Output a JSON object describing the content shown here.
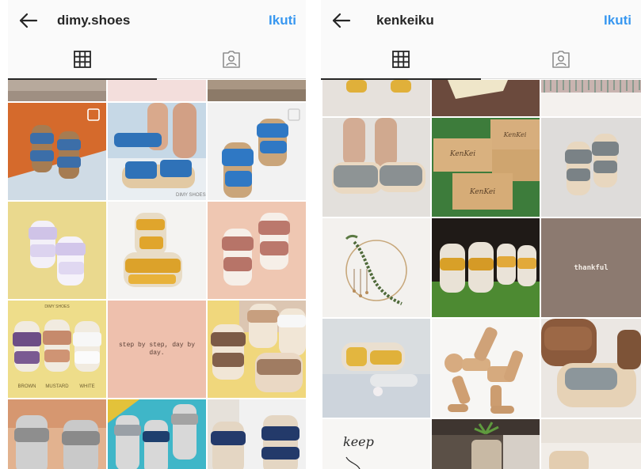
{
  "left": {
    "username": "dimy.shoes",
    "follow_label": "Ikuti",
    "tiles": {
      "watermark": "DIMY SHOES",
      "label_top": "DIMY SHOES",
      "label_brown": "BROWN",
      "label_mustard": "MUSTARD",
      "label_white": "WHITE",
      "quote": "step by step, day by day."
    }
  },
  "right": {
    "username": "kenkeiku",
    "follow_label": "Ikuti",
    "tiles": {
      "box_brand": "KenKei",
      "thankful": "thankful",
      "keep": "keep"
    }
  },
  "icons": [
    "back-arrow-icon",
    "grid-icon",
    "tagged-person-icon",
    "multi-photo-icon"
  ],
  "colors": {
    "follow": "#3897f0",
    "text": "#262626",
    "bar": "#fafafa"
  }
}
